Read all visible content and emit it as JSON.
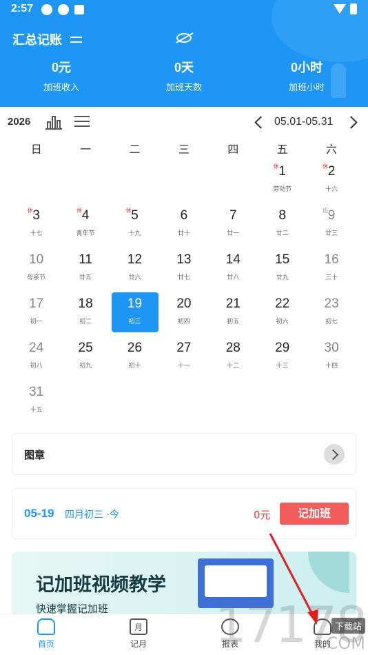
{
  "status_bar": {
    "time": "2:57"
  },
  "header": {
    "title": "汇总记账",
    "stats": [
      {
        "value": "0元",
        "label": "加班收入"
      },
      {
        "value": "0天",
        "label": "加班天数"
      },
      {
        "value": "0小时",
        "label": "加班小时"
      }
    ]
  },
  "toolbar": {
    "year": "2026",
    "range": "05.01-05.31"
  },
  "weekdays": [
    "日",
    "一",
    "二",
    "三",
    "四",
    "五",
    "六"
  ],
  "days": [
    {
      "d": "1",
      "sub": "劳动节",
      "tag": "休"
    },
    {
      "d": "2",
      "sub": "十六",
      "tag": "休"
    },
    {
      "d": "3",
      "sub": "十七",
      "tag": "休"
    },
    {
      "d": "4",
      "sub": "青年节",
      "tag": "休"
    },
    {
      "d": "5",
      "sub": "十九",
      "tag": "休"
    },
    {
      "d": "6",
      "sub": "廿十"
    },
    {
      "d": "7",
      "sub": "廿一"
    },
    {
      "d": "8",
      "sub": "廿二"
    },
    {
      "d": "9",
      "sub": "廿三",
      "tag": "班"
    },
    {
      "d": "10",
      "sub": "母亲节"
    },
    {
      "d": "11",
      "sub": "廿五"
    },
    {
      "d": "12",
      "sub": "廿六"
    },
    {
      "d": "13",
      "sub": "廿七"
    },
    {
      "d": "14",
      "sub": "廿八"
    },
    {
      "d": "15",
      "sub": "廿九"
    },
    {
      "d": "16",
      "sub": "三十"
    },
    {
      "d": "17",
      "sub": "初一"
    },
    {
      "d": "18",
      "sub": "初二"
    },
    {
      "d": "19",
      "sub": "初三"
    },
    {
      "d": "20",
      "sub": "初四"
    },
    {
      "d": "21",
      "sub": "初五"
    },
    {
      "d": "22",
      "sub": "初六"
    },
    {
      "d": "23",
      "sub": "初七"
    },
    {
      "d": "24",
      "sub": "初八"
    },
    {
      "d": "25",
      "sub": "初九"
    },
    {
      "d": "26",
      "sub": "初十"
    },
    {
      "d": "27",
      "sub": "十一"
    },
    {
      "d": "28",
      "sub": "十二"
    },
    {
      "d": "29",
      "sub": "十三"
    },
    {
      "d": "30",
      "sub": "十四"
    },
    {
      "d": "31",
      "sub": "十五"
    }
  ],
  "first_weekday": 5,
  "today": "19",
  "stamp_card": {
    "title": "图章"
  },
  "record": {
    "date": "05-19",
    "lunar": "四月初三 ·今",
    "amount": "0元",
    "button": "记加班"
  },
  "banner": {
    "title": "记加班视频教学",
    "subtitle": "快速掌握记加班"
  },
  "bottom_nav": [
    {
      "label": "首页",
      "icon": "home-icon",
      "active": true
    },
    {
      "label": "记月",
      "icon": "calendar-icon",
      "active": false,
      "icon_text": "月"
    },
    {
      "label": "报表",
      "icon": "chart-pie-icon",
      "active": false
    },
    {
      "label": "我的",
      "icon": "user-icon",
      "active": false
    }
  ],
  "watermark": {
    "number": "17178",
    "site": "下载站",
    "domain": ".COM"
  },
  "colors": {
    "primary": "#1e96f5",
    "danger": "#f45b5b",
    "holiday_tag": "#e53935"
  }
}
